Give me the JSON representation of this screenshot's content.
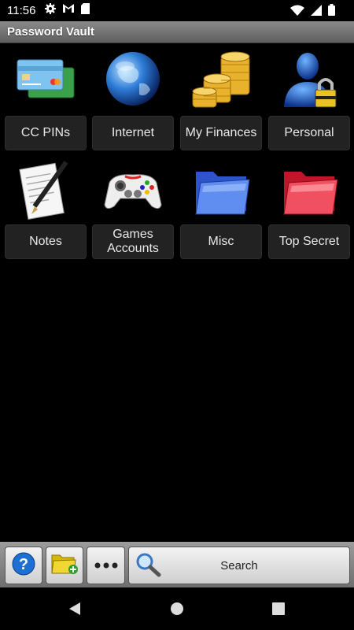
{
  "status_bar": {
    "time": "11:56",
    "icons_left": [
      "settings-icon",
      "gmail-icon",
      "sd-card-icon"
    ],
    "icons_right": [
      "wifi-icon",
      "signal-icon",
      "battery-icon"
    ]
  },
  "app": {
    "title": "Password Vault"
  },
  "categories": [
    {
      "label": "CC PINs",
      "icon": "credit-cards-icon"
    },
    {
      "label": "Internet",
      "icon": "globe-icon"
    },
    {
      "label": "My Finances",
      "icon": "coins-icon"
    },
    {
      "label": "Personal",
      "icon": "user-lock-icon"
    },
    {
      "label": "Notes",
      "icon": "notepad-pen-icon"
    },
    {
      "label": "Games Accounts",
      "icon": "gamepad-icon"
    },
    {
      "label": "Misc",
      "icon": "blue-folder-icon"
    },
    {
      "label": "Top Secret",
      "icon": "red-folder-icon"
    }
  ],
  "toolbar": {
    "help_icon": "help-icon",
    "add_folder_icon": "add-folder-icon",
    "more_icon": "more-icon",
    "search_label": "Search",
    "search_icon": "magnifier-icon"
  },
  "nav": {
    "back": "back-icon",
    "home": "home-icon",
    "recents": "recents-icon"
  }
}
